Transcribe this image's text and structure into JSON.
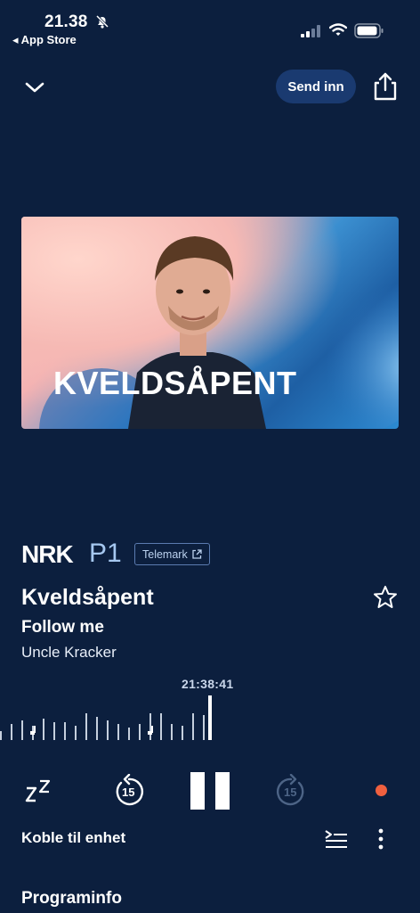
{
  "status_bar": {
    "time": "21.38",
    "back_label": "◂ App Store",
    "icons": [
      "bell-slash-icon",
      "signal-icon",
      "wifi-icon",
      "battery-icon"
    ]
  },
  "header": {
    "collapse_icon": "chevron-down-icon",
    "send_label": "Send inn",
    "share_icon": "share-icon"
  },
  "artwork": {
    "title_text": "KVELDSÅPENT"
  },
  "station": {
    "brand": "NRK",
    "channel": "P1",
    "region_label": "Telemark",
    "region_icon": "external-link-icon"
  },
  "now_playing": {
    "program_title": "Kveldsåpent",
    "song_title": "Follow me",
    "artist": "Uncle Kracker",
    "favorite_icon": "star-outline-icon"
  },
  "timeline": {
    "current_time": "21:38:41"
  },
  "controls": {
    "sleep_icon": "sleep-timer-icon",
    "rewind_label": "15",
    "forward_label": "15",
    "pause_icon": "pause-icon",
    "live_icon": "live-indicator-icon"
  },
  "bottom": {
    "connect_label": "Koble til enhet",
    "queue_icon": "queue-icon",
    "more_icon": "more-vertical-icon",
    "section_title": "Programinfo"
  },
  "colors": {
    "background": "#0c1f3e",
    "button_bg": "#1a3a70",
    "accent_light_blue": "#a6c8f0",
    "live_red": "#f0603f"
  }
}
